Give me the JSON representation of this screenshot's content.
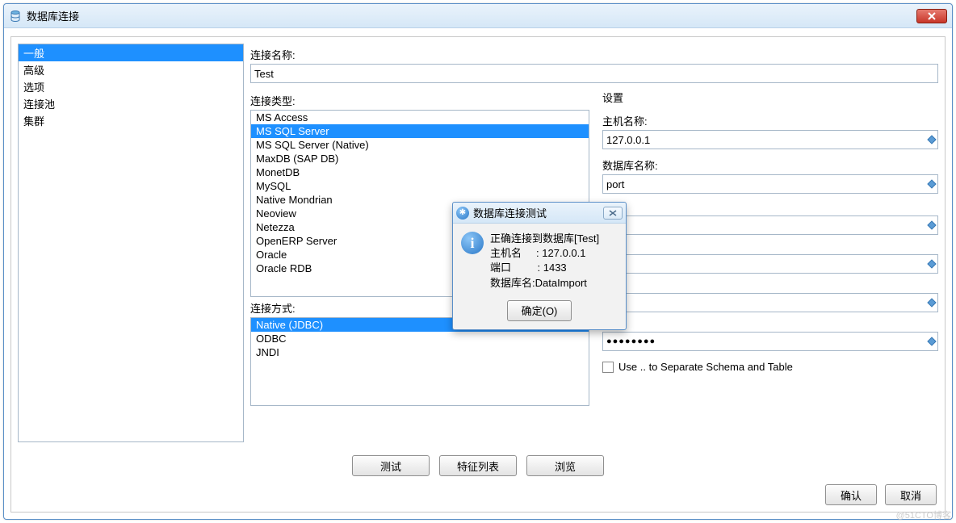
{
  "title": "数据库连接",
  "sidebar": {
    "items": [
      {
        "label": "一般",
        "selected": true
      },
      {
        "label": "高级",
        "selected": false
      },
      {
        "label": "选项",
        "selected": false
      },
      {
        "label": "连接池",
        "selected": false
      },
      {
        "label": "集群",
        "selected": false
      }
    ]
  },
  "form": {
    "conn_name_label": "连接名称:",
    "conn_name_value": "Test",
    "conn_type_label": "连接类型:",
    "conn_types": [
      "MS Access",
      "MS SQL Server",
      "MS SQL Server (Native)",
      "MaxDB (SAP DB)",
      "MonetDB",
      "MySQL",
      "Native Mondrian",
      "Neoview",
      "Netezza",
      "OpenERP Server",
      "Oracle",
      "Oracle RDB"
    ],
    "conn_type_selected": "MS SQL Server",
    "conn_method_label": "连接方式:",
    "conn_methods": [
      "Native (JDBC)",
      "ODBC",
      "JNDI"
    ],
    "conn_method_selected": "Native (JDBC)"
  },
  "settings": {
    "title": "设置",
    "host_label": "主机名称:",
    "host_value": "127.0.0.1",
    "db_label": "数据库名称:",
    "db_value_suffix": "port",
    "port_label_suffix": ":",
    "username_value_suffix": "r",
    "password_value": "●●●●●●●●",
    "checkbox_label": "Use .. to Separate Schema and Table"
  },
  "buttons": {
    "test": "测试",
    "features": "特征列表",
    "browse": "浏览",
    "ok": "确认",
    "cancel": "取消"
  },
  "dialog": {
    "title": "数据库连接测试",
    "line1": "正确连接到数据库[Test]",
    "line2": "主机名     : 127.0.0.1",
    "line3": "端口         : 1433",
    "line4": "数据库名:DataImport",
    "ok_label": "确定(O)"
  },
  "watermark": "@51CTO博客"
}
